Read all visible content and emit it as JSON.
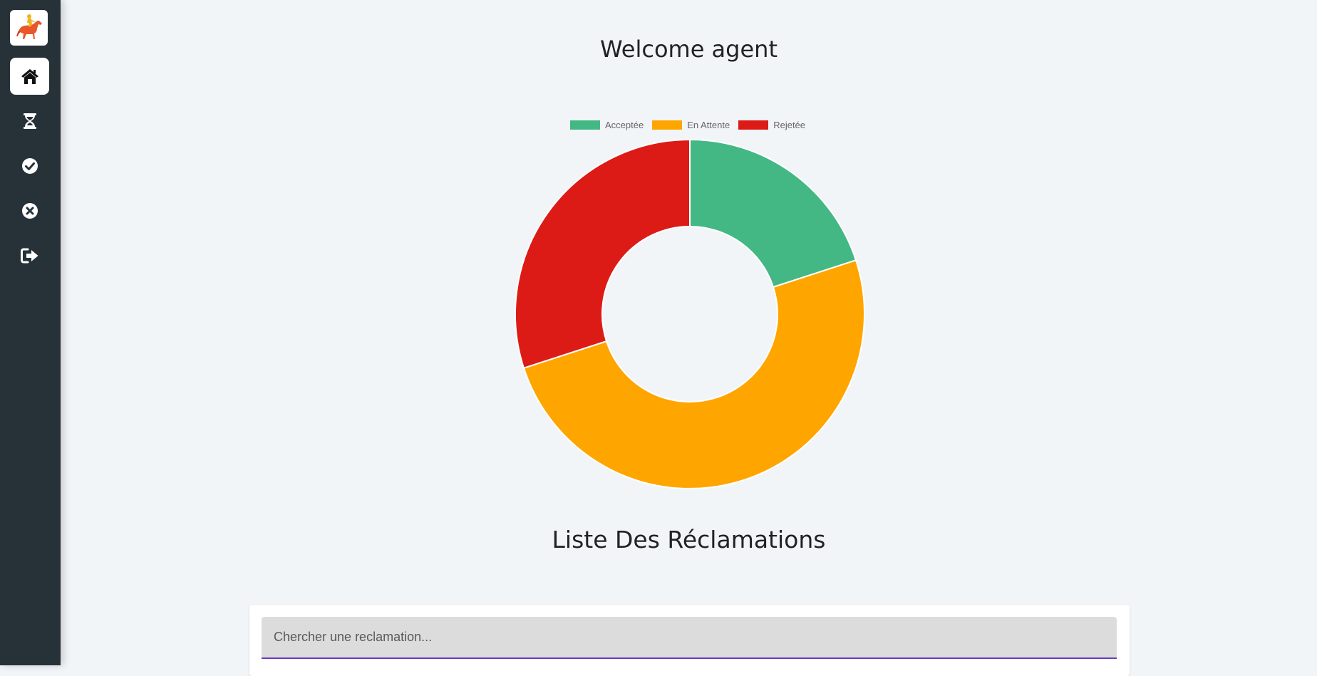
{
  "sidebar": {
    "logo_icon": "horse-rider-logo",
    "items": [
      {
        "name": "home",
        "icon": "home-icon",
        "active": true
      },
      {
        "name": "pending",
        "icon": "hourglass-icon",
        "active": false
      },
      {
        "name": "accepted",
        "icon": "check-circle-icon",
        "active": false
      },
      {
        "name": "rejected",
        "icon": "x-circle-icon",
        "active": false
      },
      {
        "name": "logout",
        "icon": "sign-out-icon",
        "active": false
      }
    ]
  },
  "main": {
    "welcome_title": "Welcome agent",
    "list_title": "Liste Des Réclamations",
    "search": {
      "placeholder": "Chercher une reclamation...",
      "value": ""
    }
  },
  "chart_data": {
    "type": "pie",
    "variant": "doughnut",
    "categories": [
      "Acceptée",
      "En Attente",
      "Rejetée"
    ],
    "values": [
      2,
      5,
      3
    ],
    "colors": [
      "#43b884",
      "#ffa500",
      "#dc1b17"
    ],
    "legend": "top",
    "title": ""
  }
}
